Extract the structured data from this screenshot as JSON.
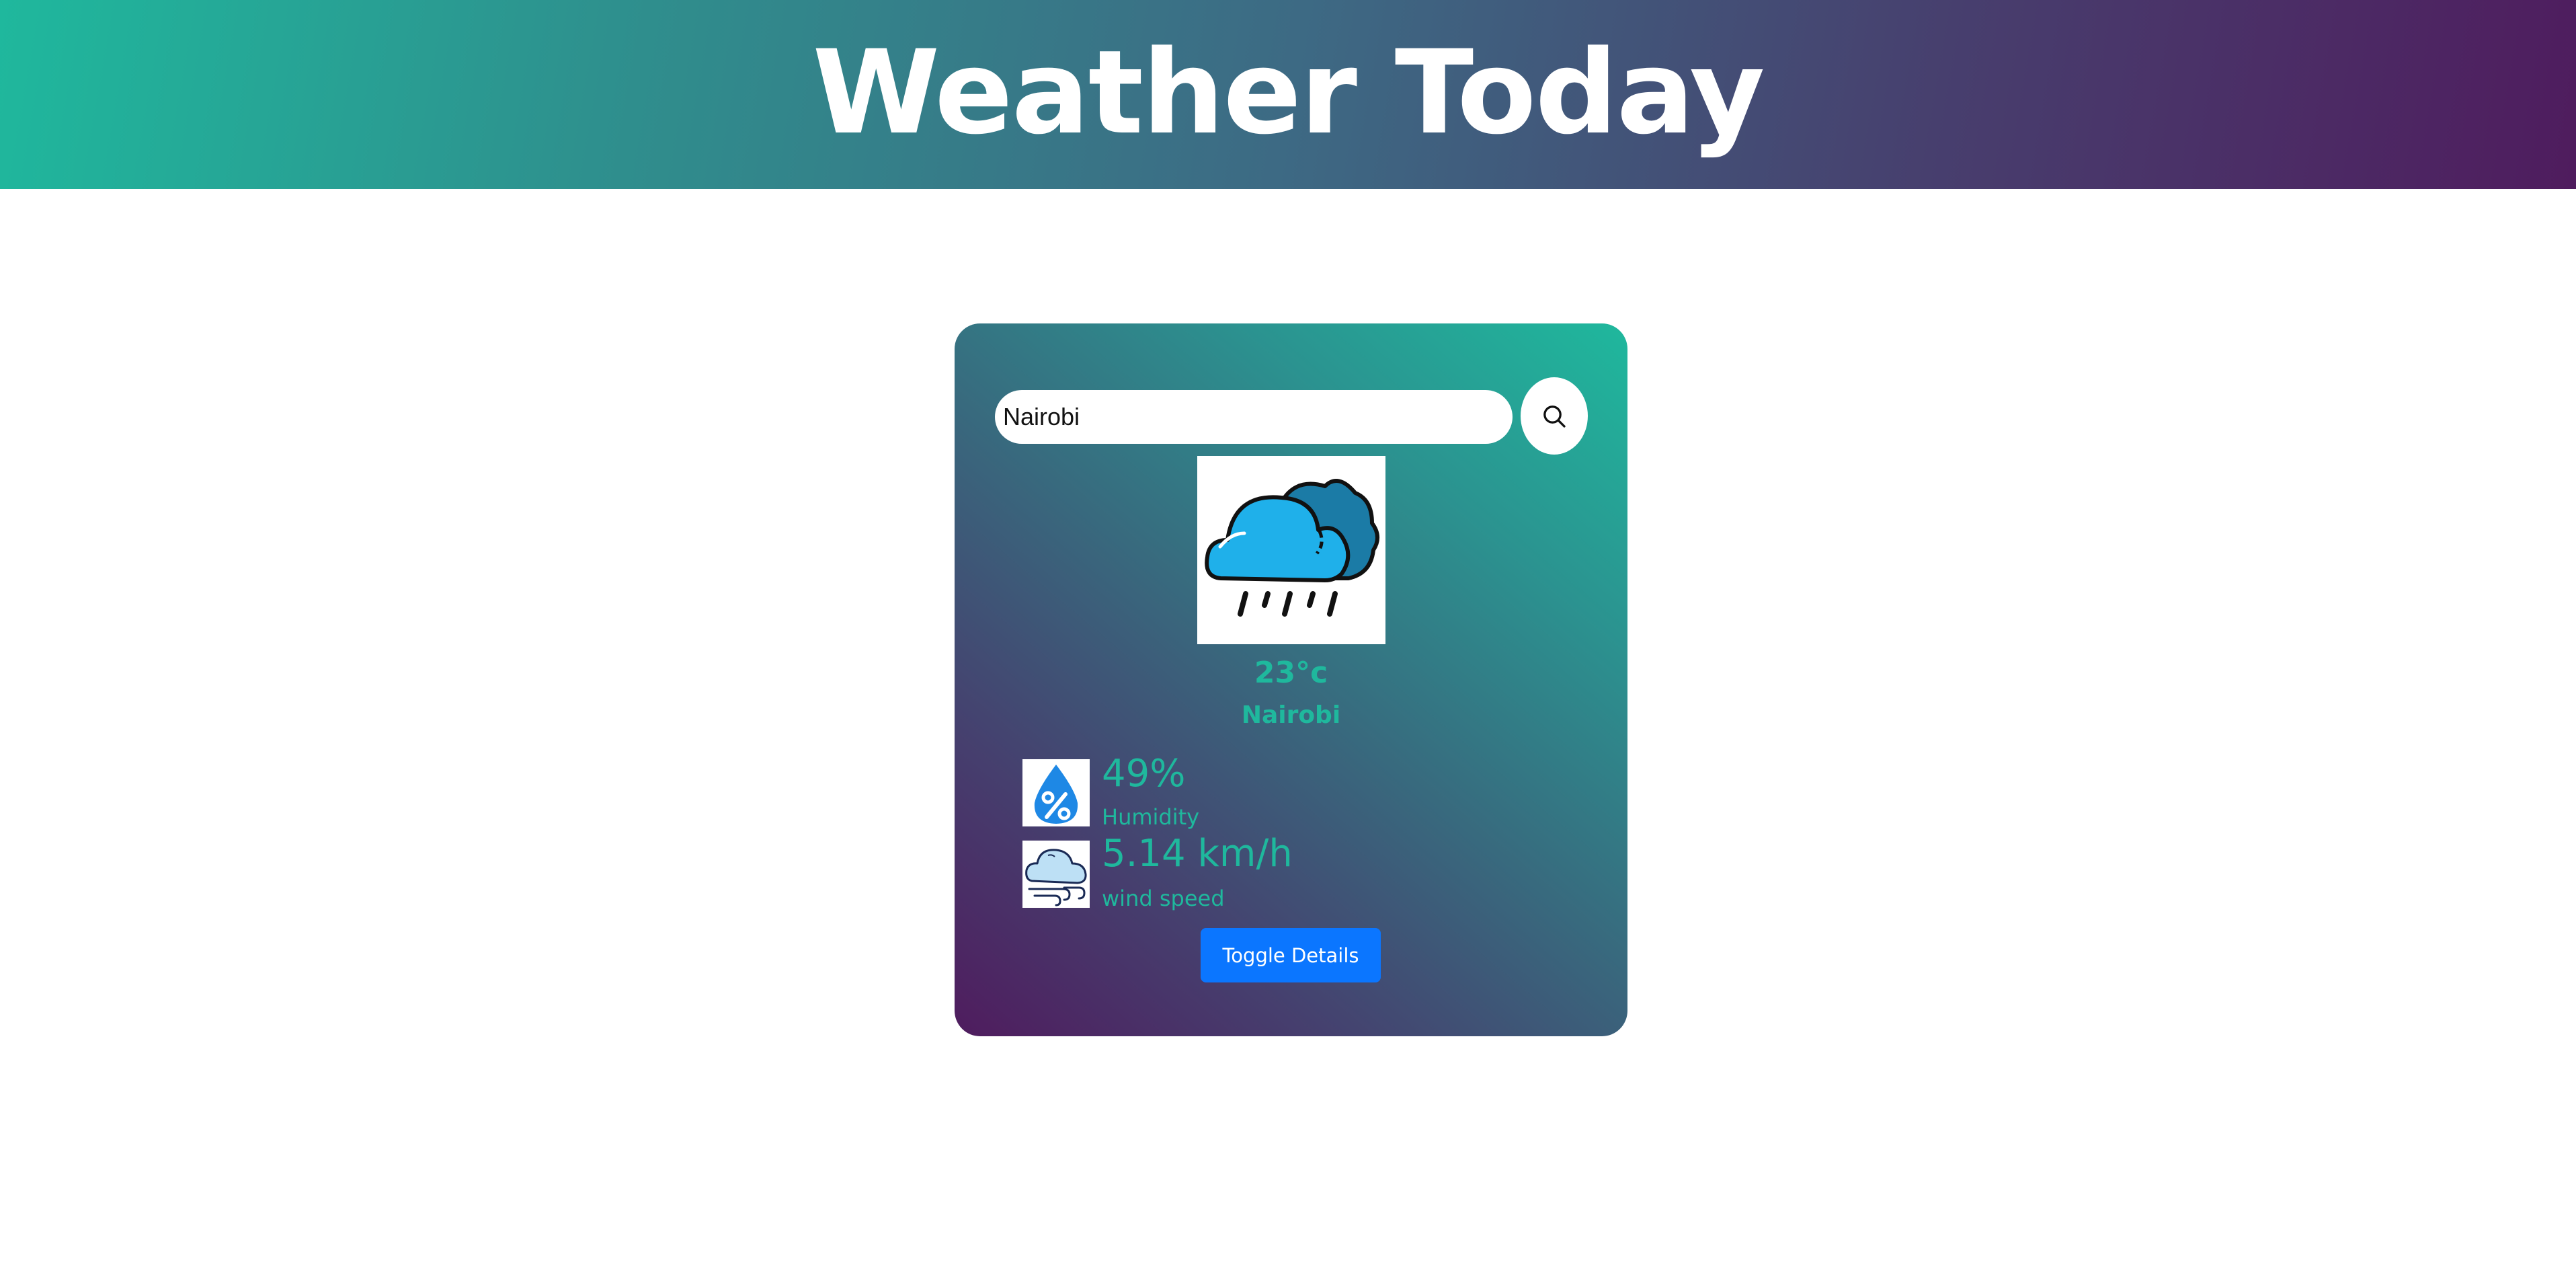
{
  "header": {
    "title": "Weather Today"
  },
  "search": {
    "value": "Nairobi"
  },
  "weather": {
    "icon": "rain-cloud-icon",
    "temperature": "23°c",
    "city": "Nairobi"
  },
  "details": {
    "humidity": {
      "value": "49%",
      "label": "Humidity",
      "icon": "humidity-drop-icon"
    },
    "wind": {
      "value": "5.14 km/h",
      "label": "wind speed",
      "icon": "wind-cloud-icon"
    }
  },
  "toggle": {
    "label": "Toggle Details"
  },
  "colors": {
    "accent": "#1fb89d",
    "purple": "#4f1c5e",
    "button": "#0b76ff",
    "rain_cloud": "#1fb0ea",
    "dark_cloud": "#1b7ba6"
  }
}
